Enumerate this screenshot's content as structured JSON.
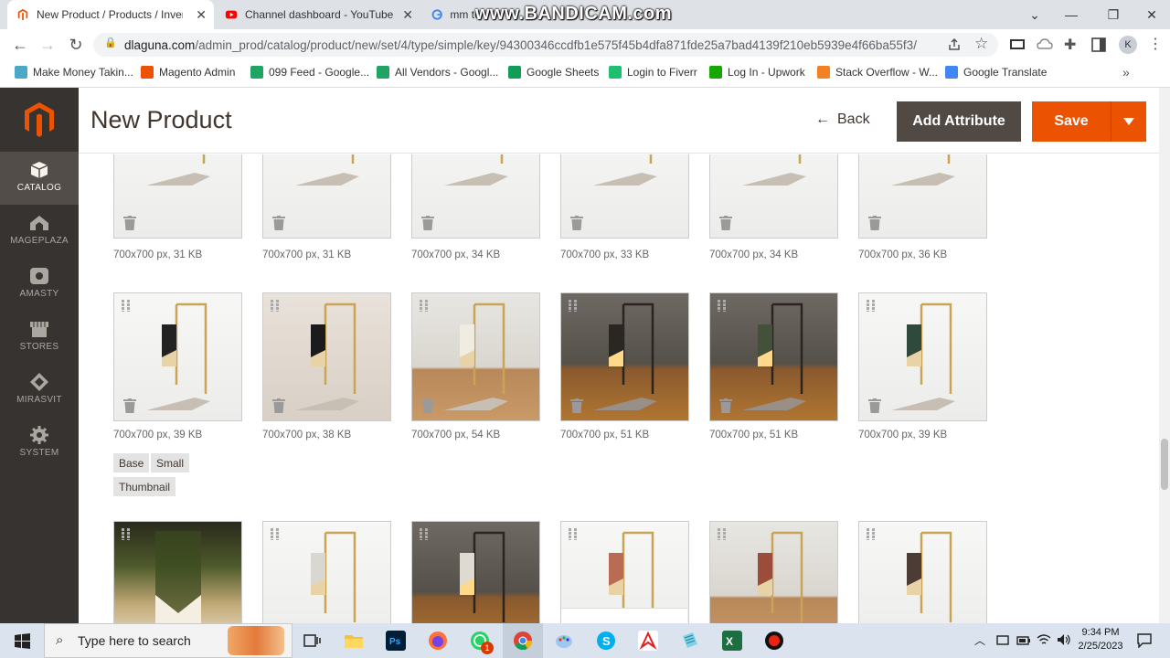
{
  "browser": {
    "tabs": [
      {
        "title": "New Product / Products / Inventory",
        "active": true
      },
      {
        "title": "Channel dashboard - YouTube Studio",
        "active": false
      },
      {
        "title": "mm te",
        "active": false
      }
    ],
    "watermark": "www.BANDICAM.com",
    "url_host": "dlaguna.com",
    "url_path": "/admin_prod/catalog/product/new/set/4/type/simple/key/94300346ccdfb1e575f45b4dfa871fde25a7bad4139f210eb5939e4f66ba55f3/",
    "profile_initial": "K",
    "bookmarks": [
      {
        "label": "Make Money Takin...",
        "color": "#4aa8c9"
      },
      {
        "label": "Magento Admin",
        "color": "#eb5202"
      },
      {
        "label": "099 Feed - Google...",
        "color": "#1fa463"
      },
      {
        "label": "All Vendors - Googl...",
        "color": "#1fa463"
      },
      {
        "label": "Google Sheets",
        "color": "#0f9d58"
      },
      {
        "label": "Login to Fiverr",
        "color": "#1dbf73"
      },
      {
        "label": "Log In - Upwork",
        "color": "#14a800"
      },
      {
        "label": "Stack Overflow - W...",
        "color": "#f48024"
      },
      {
        "label": "Google Translate",
        "color": "#4285f4"
      }
    ]
  },
  "sidebar": {
    "items": [
      {
        "label": "CATALOG",
        "icon": "cube-icon",
        "active": true
      },
      {
        "label": "MAGEPLAZA",
        "icon": "mageplaza-icon",
        "active": false
      },
      {
        "label": "AMASTY",
        "icon": "amasty-icon",
        "active": false
      },
      {
        "label": "STORES",
        "icon": "store-icon",
        "active": false
      },
      {
        "label": "MIRASVIT",
        "icon": "mirasvit-icon",
        "active": false
      },
      {
        "label": "SYSTEM",
        "icon": "gear-icon",
        "active": false
      }
    ]
  },
  "header": {
    "title": "New Product",
    "back_label": "Back",
    "add_attribute_label": "Add Attribute",
    "save_label": "Save"
  },
  "images": {
    "row1": [
      {
        "meta": "700x700 px, 31 KB",
        "tone": "light",
        "shade": "#f2efe6"
      },
      {
        "meta": "700x700 px, 31 KB",
        "tone": "light",
        "shade": "#e4e4e2"
      },
      {
        "meta": "700x700 px, 34 KB",
        "tone": "light",
        "shade": "#a08575"
      },
      {
        "meta": "700x700 px, 33 KB",
        "tone": "light",
        "shade": "#c9876e"
      },
      {
        "meta": "700x700 px, 34 KB",
        "tone": "light",
        "shade": "#3d5c4e"
      },
      {
        "meta": "700x700 px, 36 KB",
        "tone": "light",
        "shade": "#333333"
      }
    ],
    "row2": [
      {
        "meta": "700x700 px, 39 KB",
        "tone": "light",
        "shade": "#222222"
      },
      {
        "meta": "700x700 px, 38 KB",
        "tone": "beige",
        "shade": "#1b1b1b"
      },
      {
        "meta": "700x700 px, 54 KB",
        "tone": "wood",
        "shade": "#f0ece2"
      },
      {
        "meta": "700x700 px, 51 KB",
        "tone": "dark",
        "shade": "#2a2622"
      },
      {
        "meta": "700x700 px, 51 KB",
        "tone": "dark",
        "shade": "#43503a"
      },
      {
        "meta": "700x700 px, 39 KB",
        "tone": "light",
        "shade": "#2f4a3c"
      }
    ],
    "row3": [
      {
        "meta": "",
        "tone": "closeup",
        "shade": "#caa15a"
      },
      {
        "meta": "",
        "tone": "light",
        "shade": "#d9d7d2"
      },
      {
        "meta": "",
        "tone": "dark",
        "shade": "#dedad2"
      },
      {
        "meta": "",
        "tone": "light",
        "shade": "#b96b55"
      },
      {
        "meta": "",
        "tone": "wood",
        "shade": "#9c4c3a"
      },
      {
        "meta": "",
        "tone": "light",
        "shade": "#4d3b35"
      }
    ],
    "roles": [
      "Base",
      "Small",
      "Thumbnail"
    ]
  },
  "taskbar": {
    "search_placeholder": "Type here to search",
    "time": "9:34 PM",
    "date": "2/25/2023",
    "apps": [
      "task-view-icon",
      "file-explorer-icon",
      "photoshop-icon",
      "firefox-icon",
      "whatsapp-icon",
      "chrome-icon",
      "paint-icon",
      "skype-icon",
      "acrobat-icon",
      "notepad-icon",
      "excel-icon",
      "bandicam-record-icon"
    ],
    "whatsapp_badge": "1"
  },
  "colors": {
    "magento_orange": "#eb5202",
    "sidebar_bg": "#373330",
    "add_attribute_bg": "#514943"
  }
}
